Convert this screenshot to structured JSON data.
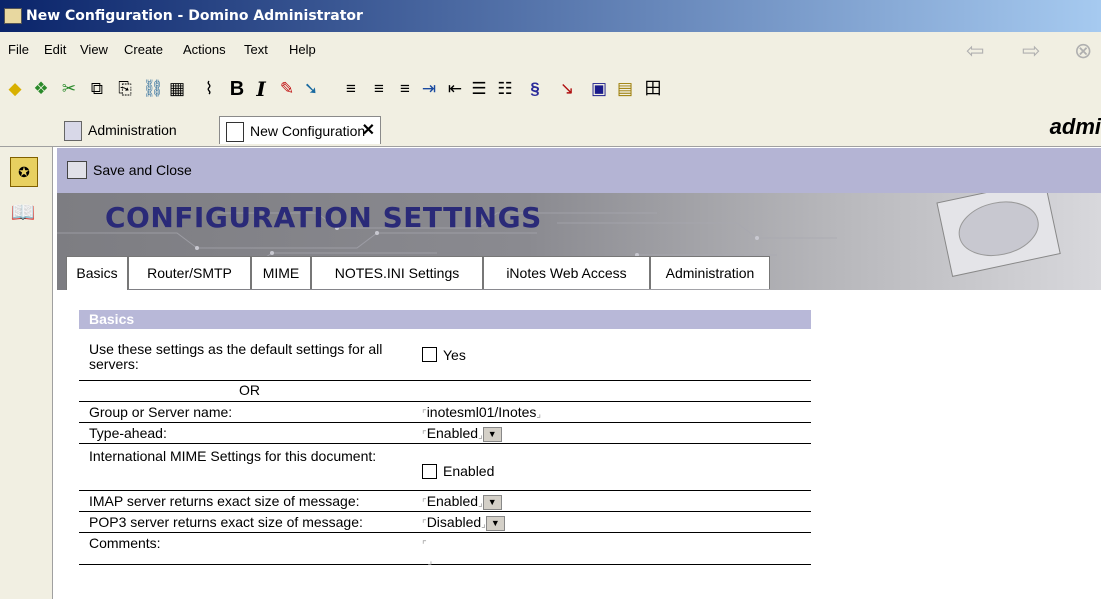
{
  "window": {
    "title": "New Configuration - Domino Administrator"
  },
  "menu": [
    "File",
    "Edit",
    "View",
    "Create",
    "Actions",
    "Text",
    "Help"
  ],
  "nav": {
    "back_icon": "back-arrow-icon",
    "forward_icon": "forward-arrow-icon"
  },
  "toolbar": {
    "icons": [
      "home-icon",
      "bookmark-icon",
      "scissors-icon",
      "copy-icon",
      "paste-icon",
      "link-icon",
      "attach-icon",
      "paperclip-icon",
      "bold-icon",
      "italic-icon",
      "highlight-icon",
      "permanent-pen-icon",
      "align-left-icon",
      "align-center-icon",
      "align-right-icon",
      "indent-icon",
      "outdent-icon",
      "bullet-list-icon",
      "number-list-icon",
      "styles-icon",
      "pointer-icon",
      "spellcheck-icon",
      "calendar-icon",
      "table-icon"
    ],
    "bold": "B",
    "italic": "I"
  },
  "tabs": [
    {
      "label": "Administration"
    },
    {
      "label": "New Configuration",
      "close": "✕"
    }
  ],
  "brand": "admi",
  "actionbar": {
    "save_close": "Save and Close"
  },
  "banner": {
    "title": "CONFIGURATION SETTINGS"
  },
  "form_tabs": [
    "Basics",
    "Router/SMTP",
    "MIME",
    "NOTES.INI Settings",
    "iNotes Web Access",
    "Administration"
  ],
  "section": {
    "title": "Basics"
  },
  "fields": {
    "default_label": "Use these settings as the default settings for all servers:",
    "default_value": "Yes",
    "or_label": "OR",
    "group_label": "Group or Server name:",
    "group_value": "inotesml01/Inotes",
    "typeahead_label": "Type-ahead:",
    "typeahead_value": "Enabled",
    "intl_mime_label": "International MIME Settings for this document:",
    "intl_mime_value": "Enabled",
    "imap_label": "IMAP server returns exact size of message:",
    "imap_value": "Enabled",
    "pop3_label": "POP3 server returns exact size of message:",
    "pop3_value": "Disabled",
    "comments_label": "Comments:"
  }
}
